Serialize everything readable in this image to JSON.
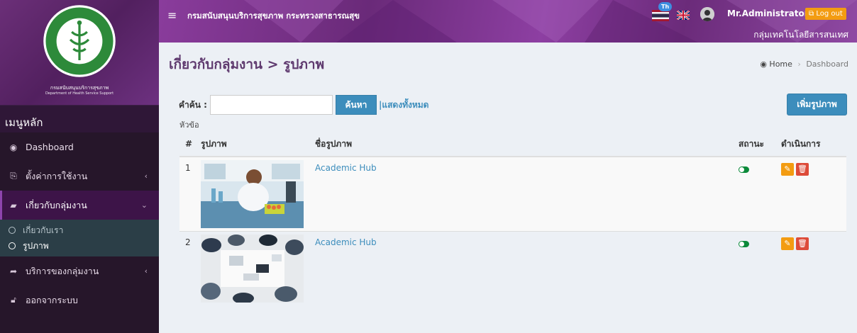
{
  "sidebar": {
    "org_name_th": "กรมสนับสนุนบริการสุขภาพ",
    "org_name_en": "Department of Health Service Support",
    "seal_text": "MINISTRY OF PUBLIC HEALTH",
    "menu_header": "เมนูหลัก",
    "items": [
      {
        "label": "Dashboard",
        "icon": "dashboard-icon"
      },
      {
        "label": "ตั้งค่าการใช้งาน",
        "icon": "settings-icon"
      },
      {
        "label": "เกี่ยวกับกลุ่มงาน",
        "icon": "book-icon"
      },
      {
        "label": "บริการของกลุ่มงาน",
        "icon": "share-icon"
      },
      {
        "label": "ออกจากระบบ",
        "icon": "lock-icon"
      }
    ],
    "subitems": [
      {
        "label": "เกี่ยวกับเรา"
      },
      {
        "label": "รูปภาพ"
      }
    ]
  },
  "header": {
    "brand": "กรมสนับสนุนบริการสุขภาพ กระทรวงสาธารณสุข",
    "lang_badge": "Th",
    "user_name": "Mr.Administrator",
    "logout_label": "Log out",
    "department": "กลุ่มเทคโนโลยีสารสนเทศ"
  },
  "page": {
    "title": "เกี่ยวกับกลุ่มงาน > รูปภาพ",
    "breadcrumb": {
      "home": "Home",
      "current": "Dashboard"
    }
  },
  "search": {
    "label": "คำค้น :",
    "value": "",
    "button": "ค้นหา",
    "show_all": "|แสดงทั้งหมด"
  },
  "add_button": "เพิ่มรูปภาพ",
  "topic_label": "หัวข้อ",
  "table": {
    "columns": [
      "#",
      "รูปภาพ",
      "ชื่อรูปภาพ",
      "สถานะ",
      "ดำเนินการ"
    ],
    "rows": [
      {
        "num": "1",
        "name": "Academic Hub",
        "status": "on"
      },
      {
        "num": "2",
        "name": "Academic Hub",
        "status": "on"
      }
    ]
  },
  "colors": {
    "sidebar_bg": "#26162a",
    "header_purple": "#7b3490",
    "primary": "#3c8dbc",
    "warning": "#f39c12",
    "danger": "#dd4b39",
    "toggle_on": "#0b8a3a"
  }
}
